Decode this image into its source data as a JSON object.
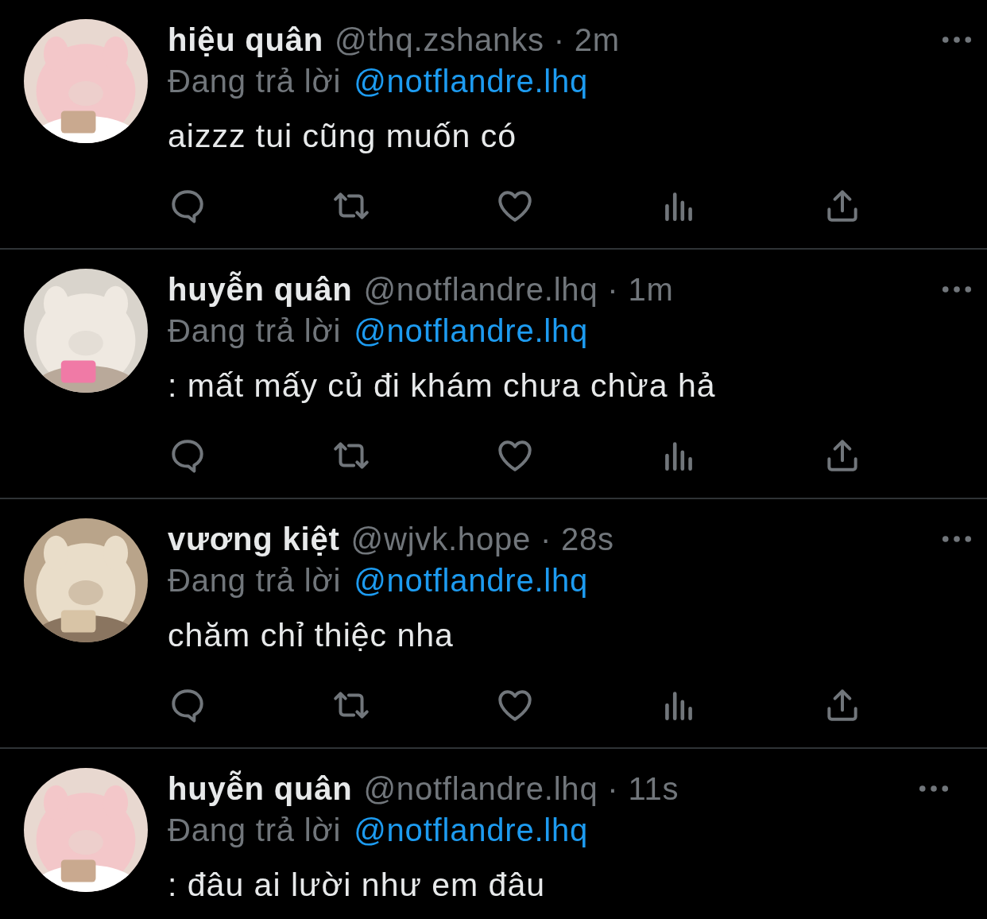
{
  "tweets": [
    {
      "name": "hiệu quân",
      "meta": "@thq.zshanks · 2m",
      "reply_prefix": "Đang trả lời",
      "reply_to": "@notflandre.lhq",
      "text": "aizzz tui cũng muốn có",
      "actions": true
    },
    {
      "name": "huyễn quân",
      "meta": "@notflandre.lhq · 1m",
      "reply_prefix": "Đang trả lời",
      "reply_to": "@notflandre.lhq",
      "text": ": mất mấy củ đi khám chưa chừa hả",
      "actions": true
    },
    {
      "name": "vương kiệt",
      "meta": "@wjvk.hope · 28s",
      "reply_prefix": "Đang trả lời",
      "reply_to": "@notflandre.lhq",
      "text": "chăm chỉ thiệc nha",
      "actions": true
    },
    {
      "name": "huyễn quân",
      "meta": "@notflandre.lhq · 11s",
      "reply_prefix": "Đang trả lời",
      "reply_to": "@notflandre.lhq",
      "text": ": đâu ai lười như em đâu",
      "actions": false
    }
  ]
}
